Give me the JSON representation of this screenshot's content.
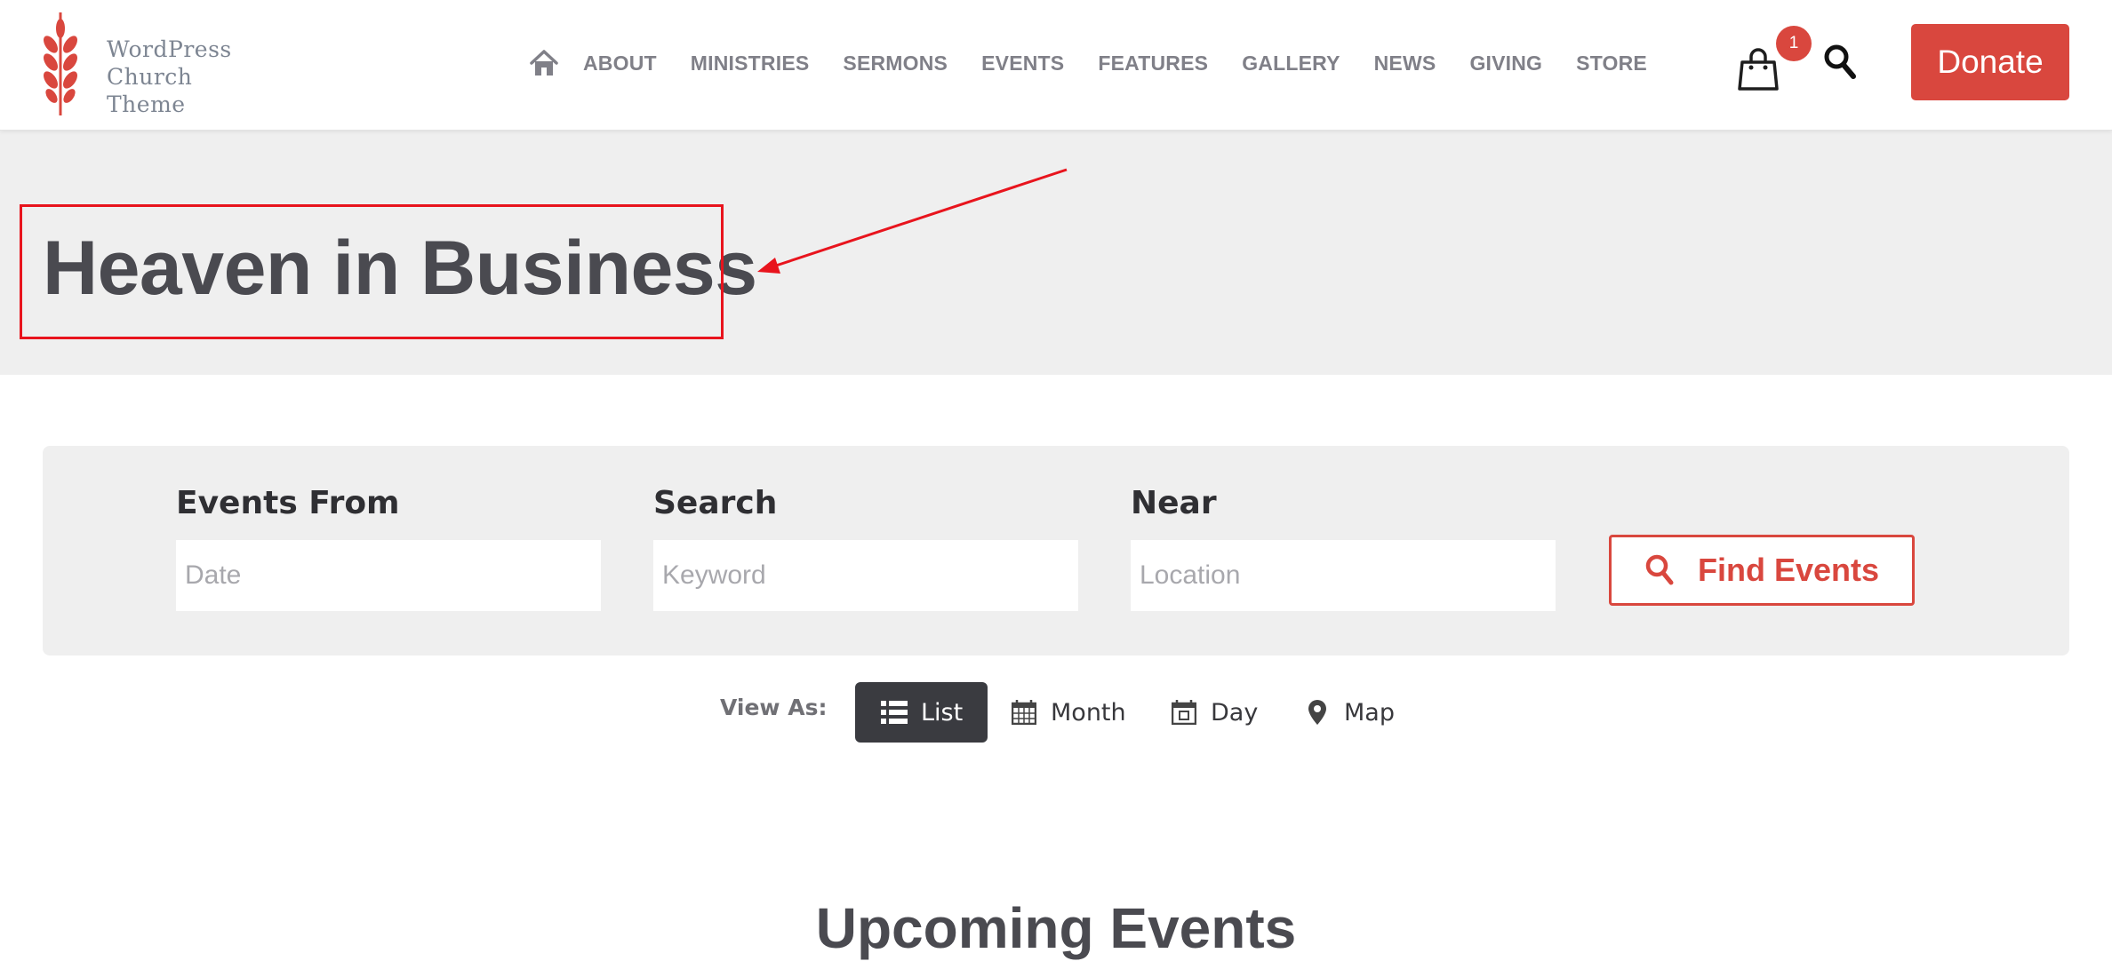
{
  "site": {
    "logo_lines": [
      "WordPress",
      "Church",
      "Theme"
    ],
    "brand_color": "#d9473e",
    "logo_icon": "wheat-icon"
  },
  "nav": {
    "home_icon": "home-icon",
    "items": [
      "ABOUT",
      "MINISTRIES",
      "SERMONS",
      "EVENTS",
      "FEATURES",
      "GALLERY",
      "NEWS",
      "GIVING",
      "STORE"
    ]
  },
  "header_actions": {
    "cart_icon": "shopping-bag-icon",
    "cart_count": "1",
    "search_icon": "search-icon",
    "donate_label": "Donate"
  },
  "page": {
    "title": "Heaven in Business",
    "annotation_color": "#e8141d"
  },
  "event_search": {
    "from_label": "Events From",
    "from_placeholder": "Date",
    "search_label": "Search",
    "search_placeholder": "Keyword",
    "near_label": "Near",
    "near_placeholder": "Location",
    "find_label": "Find Events",
    "find_icon": "search-icon"
  },
  "view_as": {
    "label": "View As:",
    "options": [
      {
        "label": "List",
        "icon": "list-icon",
        "active": true
      },
      {
        "label": "Month",
        "icon": "calendar-month-icon",
        "active": false
      },
      {
        "label": "Day",
        "icon": "calendar-day-icon",
        "active": false
      },
      {
        "label": "Map",
        "icon": "map-pin-icon",
        "active": false
      }
    ]
  },
  "upcoming": {
    "title": "Upcoming Events"
  }
}
